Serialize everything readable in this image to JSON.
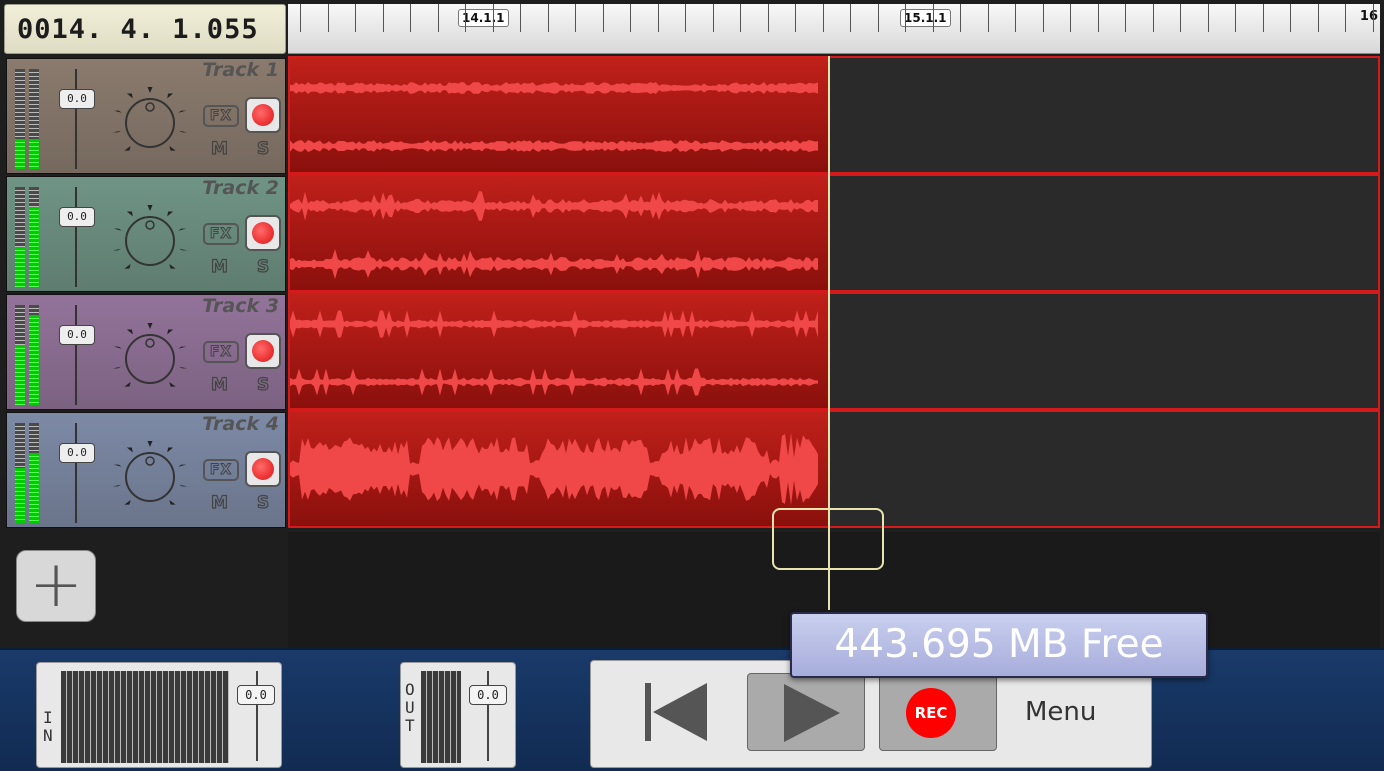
{
  "header": {
    "position": "0014. 4. 1.055",
    "ruler_marks": [
      "14.1.1",
      "15.1.1",
      "16"
    ]
  },
  "tracks": [
    {
      "name": "Track 1",
      "volume": "0.0",
      "fx": "FX",
      "mute": "M",
      "solo": "S",
      "color": "#8b7b6e"
    },
    {
      "name": "Track 2",
      "volume": "0.0",
      "fx": "FX",
      "mute": "M",
      "solo": "S",
      "color": "#6f9485"
    },
    {
      "name": "Track 3",
      "volume": "0.0",
      "fx": "FX",
      "mute": "M",
      "solo": "S",
      "color": "#93739a"
    },
    {
      "name": "Track 4",
      "volume": "0.0",
      "fx": "FX",
      "mute": "M",
      "solo": "S",
      "color": "#7d8aa6"
    }
  ],
  "bottom": {
    "in_label": "IN",
    "in_volume": "0.0",
    "out_label": "OUT",
    "out_volume": "0.0",
    "rec_label": "REC",
    "menu_label": "Menu"
  },
  "status": {
    "free_space": "443.695 MB Free"
  },
  "colors": {
    "clip": "#c0201a",
    "lane_border": "#d41a1a",
    "playhead": "#e8e4b0",
    "bottom_bar": "#1a3a6a"
  }
}
